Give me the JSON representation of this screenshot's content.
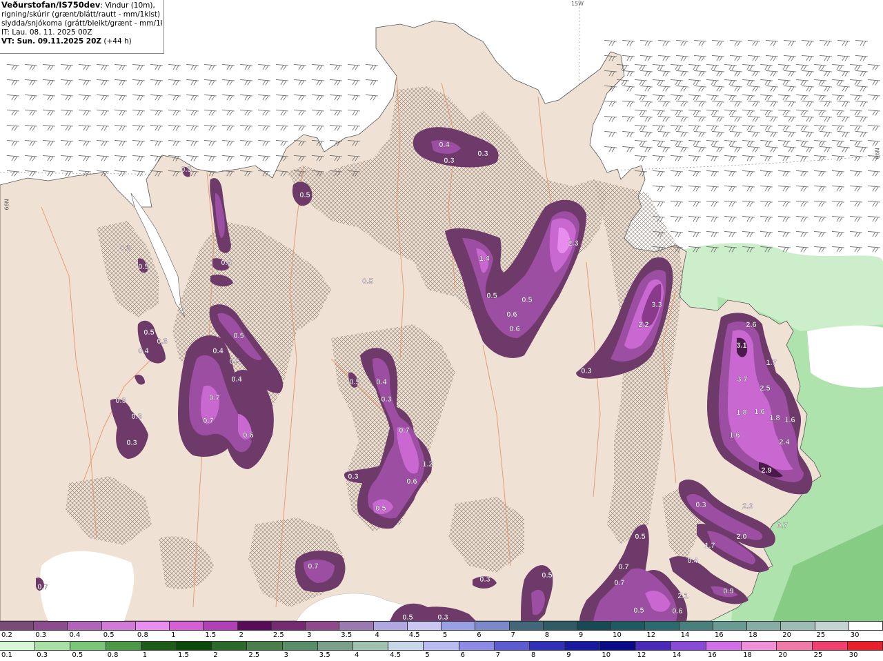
{
  "info": {
    "title": "Veðurstofan/IS750dev",
    "title_suffix": ": Vindur (10m),",
    "line2": "rigning/skúrir (grænt/blátt/rautt - mm/1klst) og",
    "line3": "slydda/snjókoma (grátt/bleikt/grænt - mm/1klst)",
    "line4": "IT: Lau. 08. 11. 2025 00Z",
    "line5_bold": "VT: Sun. 09.11.2025 20Z",
    "line5_rest": " (+44 h)"
  },
  "grid_labels": {
    "top": "15W",
    "left": "66N",
    "right": "66N"
  },
  "colors": {
    "sea": "#ffffff",
    "land": "#efe2d4",
    "hatch": "#8a7a70",
    "rivers": "#e8926a",
    "precip_light": "#6e3a6a",
    "precip_mid": "#a84fb0",
    "precip_high": "#d56ee0",
    "precip_peak": "#f08cf5",
    "rain_light": "#c8efc6",
    "rain_mid": "#98dc97"
  },
  "precip_labels": [
    {
      "text": "0.4"
    },
    {
      "text": "0.3"
    },
    {
      "text": "0.3"
    },
    {
      "text": "0.5"
    },
    {
      "text": "2.3"
    },
    {
      "text": "1.4"
    },
    {
      "text": "0.5"
    },
    {
      "text": "0.5"
    },
    {
      "text": "0.6"
    },
    {
      "text": "0.6"
    },
    {
      "text": "3.3"
    },
    {
      "text": "2.2"
    },
    {
      "text": "0.3"
    },
    {
      "text": "2.6"
    },
    {
      "text": "3.1"
    },
    {
      "text": "1.7"
    },
    {
      "text": "3.7"
    },
    {
      "text": "2.5"
    },
    {
      "text": "1.8"
    },
    {
      "text": "1.6"
    },
    {
      "text": "1.8"
    },
    {
      "text": "1.6"
    },
    {
      "text": "1.6"
    },
    {
      "text": "2.4"
    },
    {
      "text": "2.9"
    },
    {
      "text": "0.3"
    },
    {
      "text": "2.0"
    },
    {
      "text": "2.0"
    },
    {
      "text": "0.7"
    },
    {
      "text": "1.7"
    },
    {
      "text": "0.4"
    },
    {
      "text": "0.9"
    },
    {
      "text": "2.1"
    },
    {
      "text": "0.6"
    },
    {
      "text": "0.5"
    },
    {
      "text": "0.7"
    },
    {
      "text": "0.7"
    },
    {
      "text": "0.5"
    },
    {
      "text": "0.3"
    },
    {
      "text": "0.5"
    },
    {
      "text": "0.5"
    },
    {
      "text": "0.3"
    },
    {
      "text": "0.7"
    },
    {
      "text": "0.4"
    },
    {
      "text": "0.5"
    },
    {
      "text": "0.5"
    },
    {
      "text": "0.3"
    },
    {
      "text": "0.7"
    },
    {
      "text": "1.2"
    },
    {
      "text": "0.6"
    },
    {
      "text": "0.3"
    },
    {
      "text": "0.5"
    },
    {
      "text": "0.5"
    },
    {
      "text": "0.4"
    },
    {
      "text": "0.5"
    },
    {
      "text": "0.4"
    },
    {
      "text": "0.7"
    },
    {
      "text": "0.7"
    },
    {
      "text": "0.6"
    },
    {
      "text": "0.5"
    },
    {
      "text": "0.4"
    },
    {
      "text": "0.3"
    },
    {
      "text": "0.3"
    },
    {
      "text": "0.3"
    },
    {
      "text": "0.3"
    },
    {
      "text": "0.7"
    },
    {
      "text": "0.5"
    },
    {
      "text": "0.5"
    },
    {
      "text": "0.3"
    },
    {
      "text": "0.5"
    }
  ],
  "scale_top": {
    "labels": [
      "0.2",
      "0.3",
      "0.4",
      "0.5",
      "0.8",
      "1",
      "1.5",
      "2",
      "2.5",
      "3",
      "3.5",
      "4",
      "4.5",
      "5",
      "6",
      "7",
      "8",
      "9",
      "10",
      "12",
      "14",
      "16",
      "18",
      "20",
      "25",
      "30"
    ],
    "colors": [
      "#7a4a78",
      "#8d4c8e",
      "#b264b9",
      "#d27ad8",
      "#e98ef0",
      "#d65fd8",
      "#b33fb8",
      "#5a0a5a",
      "#762a72",
      "#8e4a8a",
      "#9a7ab0",
      "#b0a8e0",
      "#c8c8f2",
      "#9aa0e6",
      "#7c88cc",
      "#43677a",
      "#2e5b66",
      "#174a55",
      "#1f5a62",
      "#2d6a70",
      "#48807e",
      "#6a9a94",
      "#86aea6",
      "#9cbcb4",
      "#c4d4d0",
      "#ffffff"
    ]
  },
  "scale_bottom": {
    "labels": [
      "0.1",
      "0.3",
      "0.5",
      "0.8",
      "1",
      "1.5",
      "2",
      "2.5",
      "3",
      "3.5",
      "4",
      "4.5",
      "5",
      "6",
      "7",
      "8",
      "9",
      "10",
      "12",
      "14",
      "16",
      "18",
      "20",
      "25",
      "30"
    ],
    "colors": [
      "#d8f5d6",
      "#a8e0a6",
      "#7cc67a",
      "#4c9a48",
      "#1e5c1a",
      "#0c4a0c",
      "#2c6a2c",
      "#4a7e4a",
      "#5a8e6a",
      "#7aa08a",
      "#a0c0b0",
      "#c8d8e8",
      "#b8bcf0",
      "#8c8ce6",
      "#5c5cd0",
      "#3030b8",
      "#1a1aa0",
      "#0a0a88",
      "#4a2ab8",
      "#8a4ad8",
      "#d070e8",
      "#f090d8",
      "#f07aa8",
      "#f04070",
      "#e8202c"
    ]
  }
}
